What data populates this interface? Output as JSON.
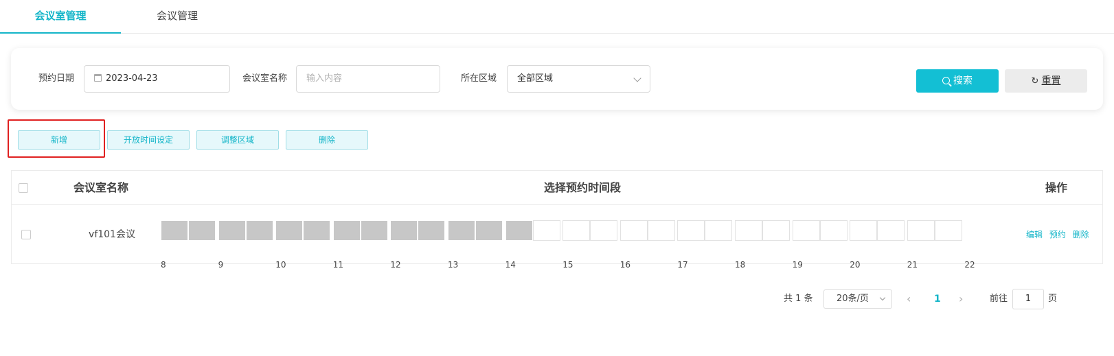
{
  "tabs": [
    {
      "label": "会议室管理",
      "active": true
    },
    {
      "label": "会议管理",
      "active": false
    }
  ],
  "filters": {
    "date_label": "预约日期",
    "date_value": "2023-04-23",
    "room_name_label": "会议室名称",
    "room_name_placeholder": "输入内容",
    "area_label": "所在区域",
    "area_value": "全部区域",
    "search_label": "搜索",
    "reset_label": "重置"
  },
  "actions": {
    "add": "新增",
    "open_time": "开放时间设定",
    "adjust_area": "调整区域",
    "delete": "删除"
  },
  "table": {
    "headers": {
      "name": "会议室名称",
      "timeslot": "选择预约时间段",
      "ops": "操作"
    },
    "rows": [
      {
        "name": "vf101会议",
        "ops": {
          "edit": "编辑",
          "book": "预约",
          "delete": "删除"
        },
        "booked_slots": [
          true,
          true,
          true,
          true,
          true,
          true,
          true,
          true,
          true,
          true,
          true,
          true,
          true,
          false,
          false,
          false,
          false,
          false,
          false,
          false,
          false,
          false,
          false,
          false,
          false,
          false,
          false,
          false
        ]
      }
    ],
    "hours": [
      "8",
      "9",
      "10",
      "11",
      "12",
      "13",
      "14",
      "15",
      "16",
      "17",
      "18",
      "19",
      "20",
      "21",
      "22"
    ]
  },
  "pagination": {
    "total": "共 1 条",
    "page_size": "20条/页",
    "prev": "‹",
    "current_page": "1",
    "next": "›",
    "goto_label": "前往",
    "goto_value": "1",
    "goto_unit": "页"
  },
  "colors": {
    "accent": "#13b5c8",
    "booked": "#c7c7c7",
    "highlight": "#e02020"
  }
}
